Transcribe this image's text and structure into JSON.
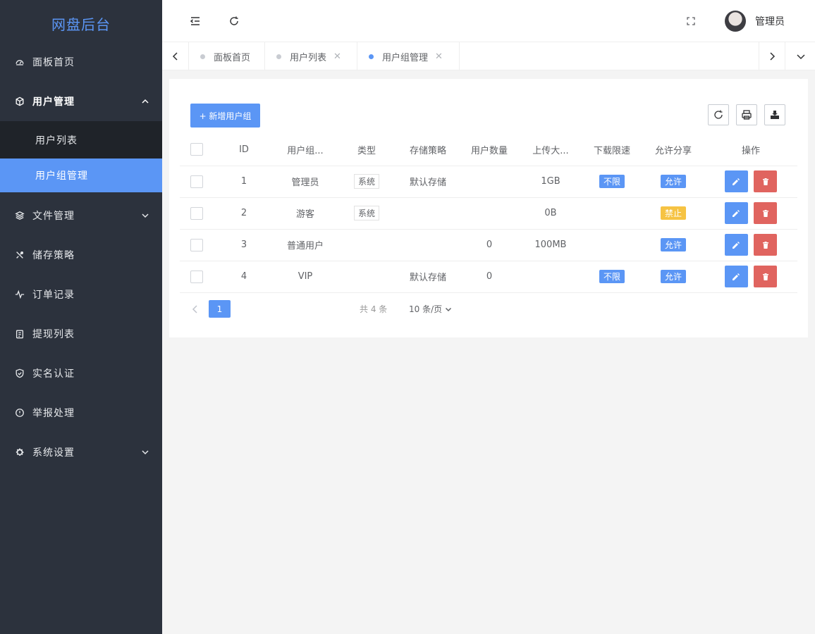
{
  "app": {
    "logo": "网盘后台"
  },
  "sidebar": {
    "items": [
      {
        "label": "面板首页",
        "icon": "dashboard-icon"
      },
      {
        "label": "用户管理",
        "icon": "cube-icon",
        "expanded": true,
        "children": [
          {
            "label": "用户列表"
          },
          {
            "label": "用户组管理",
            "active": true
          }
        ]
      },
      {
        "label": "文件管理",
        "icon": "layers-icon",
        "expandable": true
      },
      {
        "label": "储存策略",
        "icon": "tools-icon"
      },
      {
        "label": "订单记录",
        "icon": "pulse-icon"
      },
      {
        "label": "提现列表",
        "icon": "clipboard-icon"
      },
      {
        "label": "实名认证",
        "icon": "shield-check-icon"
      },
      {
        "label": "举报处理",
        "icon": "alert-circle-icon"
      },
      {
        "label": "系统设置",
        "icon": "gear-icon",
        "expandable": true
      }
    ]
  },
  "header": {
    "username": "管理员"
  },
  "tabs": [
    {
      "label": "面板首页",
      "closable": false
    },
    {
      "label": "用户列表",
      "closable": true
    },
    {
      "label": "用户组管理",
      "closable": true,
      "active": true
    }
  ],
  "toolbar": {
    "add_label": "+ 新增用户组"
  },
  "table": {
    "headers": [
      "ID",
      "用户组...",
      "类型",
      "存储策略",
      "用户数量",
      "上传大...",
      "下载限速",
      "允许分享",
      "操作"
    ],
    "rows": [
      {
        "id": "1",
        "name": "管理员",
        "type": "系统",
        "policy": "默认存储",
        "users": "",
        "upload": "1GB",
        "download": "不限",
        "share": "允许",
        "share_color": "blue"
      },
      {
        "id": "2",
        "name": "游客",
        "type": "系统",
        "policy": "",
        "users": "",
        "upload": "0B",
        "download": "",
        "share": "禁止",
        "share_color": "yellow"
      },
      {
        "id": "3",
        "name": "普通用户",
        "type": "",
        "policy": "",
        "users": "0",
        "upload": "100MB",
        "download": "",
        "share": "允许",
        "share_color": "blue"
      },
      {
        "id": "4",
        "name": "VIP",
        "type": "",
        "policy": "默认存储",
        "users": "0",
        "upload": "",
        "download": "不限",
        "share": "允许",
        "share_color": "blue"
      }
    ]
  },
  "pagination": {
    "current": "1",
    "total_label": "共 4 条",
    "page_size": "10 条/页"
  },
  "colors": {
    "accent": "#5b96f5",
    "danger": "#e0645f",
    "sidebar_bg": "#2c323d"
  }
}
